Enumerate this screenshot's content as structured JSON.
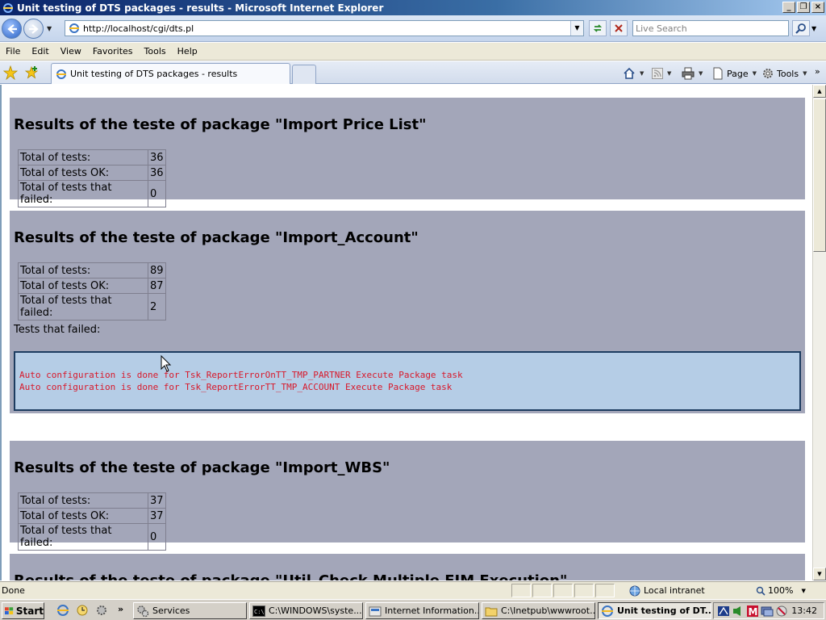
{
  "window": {
    "title": "Unit testing of DTS packages - results - Microsoft Internet Explorer",
    "min_label": "_",
    "max_label": "❐",
    "close_label": "×"
  },
  "nav": {
    "url": "http://localhost/cgi/dts.pl",
    "search_placeholder": "Live Search"
  },
  "menu": {
    "items": [
      "File",
      "Edit",
      "View",
      "Favorites",
      "Tools",
      "Help"
    ]
  },
  "tabs": {
    "active_label": "Unit testing of DTS packages - results"
  },
  "commands": {
    "page_label": "Page",
    "tools_label": "Tools",
    "more_label": "»"
  },
  "packages": [
    {
      "title": "Results of the teste of package \"Import Price List\"",
      "stats": [
        {
          "label": "Total of tests:",
          "value": "36"
        },
        {
          "label": "Total of tests OK:",
          "value": "36"
        },
        {
          "label": "Total of tests that failed:",
          "value": "0"
        }
      ]
    },
    {
      "title": "Results of the teste of package \"Import_Account\"",
      "stats": [
        {
          "label": "Total of tests:",
          "value": "89"
        },
        {
          "label": "Total of tests OK:",
          "value": "87"
        },
        {
          "label": "Total of tests that failed:",
          "value": "2"
        }
      ],
      "failed_label": "Tests that failed:",
      "failed_lines": [
        "Auto configuration is done for Tsk_ReportErrorOnTT_TMP_PARTNER Execute Package task",
        "Auto configuration is done for Tsk_ReportErrorTT_TMP_ACCOUNT Execute Package task"
      ]
    },
    {
      "title": "Results of the teste of package \"Import_WBS\"",
      "stats": [
        {
          "label": "Total of tests:",
          "value": "37"
        },
        {
          "label": "Total of tests OK:",
          "value": "37"
        },
        {
          "label": "Total of tests that failed:",
          "value": "0"
        }
      ]
    },
    {
      "title": "Results of the teste of package \"Util_Check Multiple FIM Execution\""
    }
  ],
  "status": {
    "text": "Done",
    "zone": "Local intranet",
    "zoom": "100%"
  },
  "taskbar": {
    "start_label": "Start",
    "quicklaunch_more": "»",
    "tasks": [
      {
        "label": "Services"
      },
      {
        "label": "C:\\WINDOWS\\syste..."
      },
      {
        "label": "Internet Information..."
      },
      {
        "label": "C:\\Inetpub\\wwwroot..."
      },
      {
        "label": "Unit testing of DT..."
      }
    ],
    "clock": "13:42"
  },
  "colors": {
    "section_bg": "#a3a6b9",
    "failed_box_bg": "#b5cde6",
    "failed_text": "#d8182a"
  }
}
